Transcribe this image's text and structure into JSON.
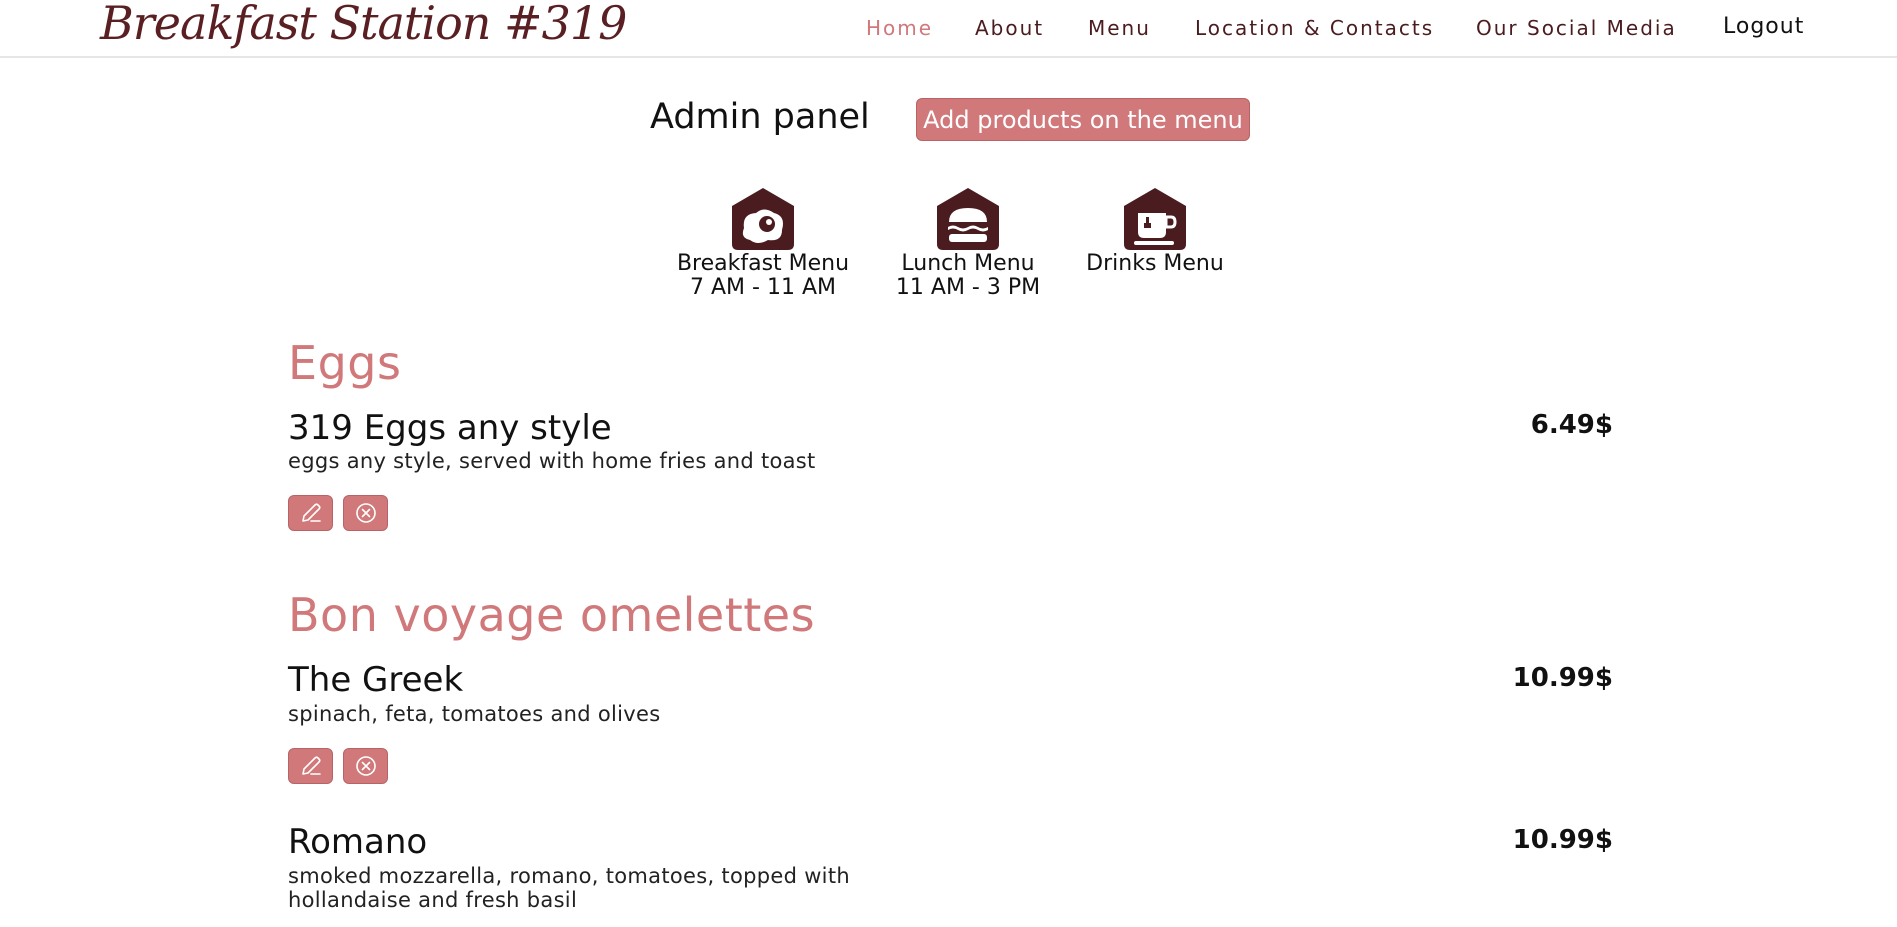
{
  "header": {
    "brand": "Breakfast Station #319",
    "nav": [
      {
        "label": "Home",
        "active": true
      },
      {
        "label": "About"
      },
      {
        "label": "Menu"
      },
      {
        "label": "Location & Contacts"
      },
      {
        "label": "Our Social Media"
      }
    ],
    "logout": "Logout"
  },
  "admin": {
    "title": "Admin panel",
    "add_button": "Add products on the menu"
  },
  "categories": [
    {
      "icon": "fried-egg-icon",
      "label": "Breakfast Menu",
      "hours": "7 AM - 11 AM"
    },
    {
      "icon": "burger-icon",
      "label": "Lunch Menu",
      "hours": "11 AM - 3 PM"
    },
    {
      "icon": "coffee-cup-icon",
      "label": "Drinks Menu",
      "hours": ""
    }
  ],
  "sections": [
    {
      "title": "Eggs",
      "items": [
        {
          "name": "319 Eggs any style",
          "description": "eggs any style, served with home fries and toast",
          "price": "6.49$"
        }
      ]
    },
    {
      "title": "Bon voyage omelettes",
      "items": [
        {
          "name": "The Greek",
          "description": "spinach, feta, tomatoes and olives",
          "price": "10.99$"
        },
        {
          "name": "Romano",
          "description": "smoked mozzarella, romano, tomatoes, topped with hollandaise and fresh basil",
          "price": "10.99$"
        }
      ]
    }
  ],
  "colors": {
    "accent": "#d0787a",
    "brand": "#5a1f22",
    "icon_dark": "#4a1c1f"
  }
}
